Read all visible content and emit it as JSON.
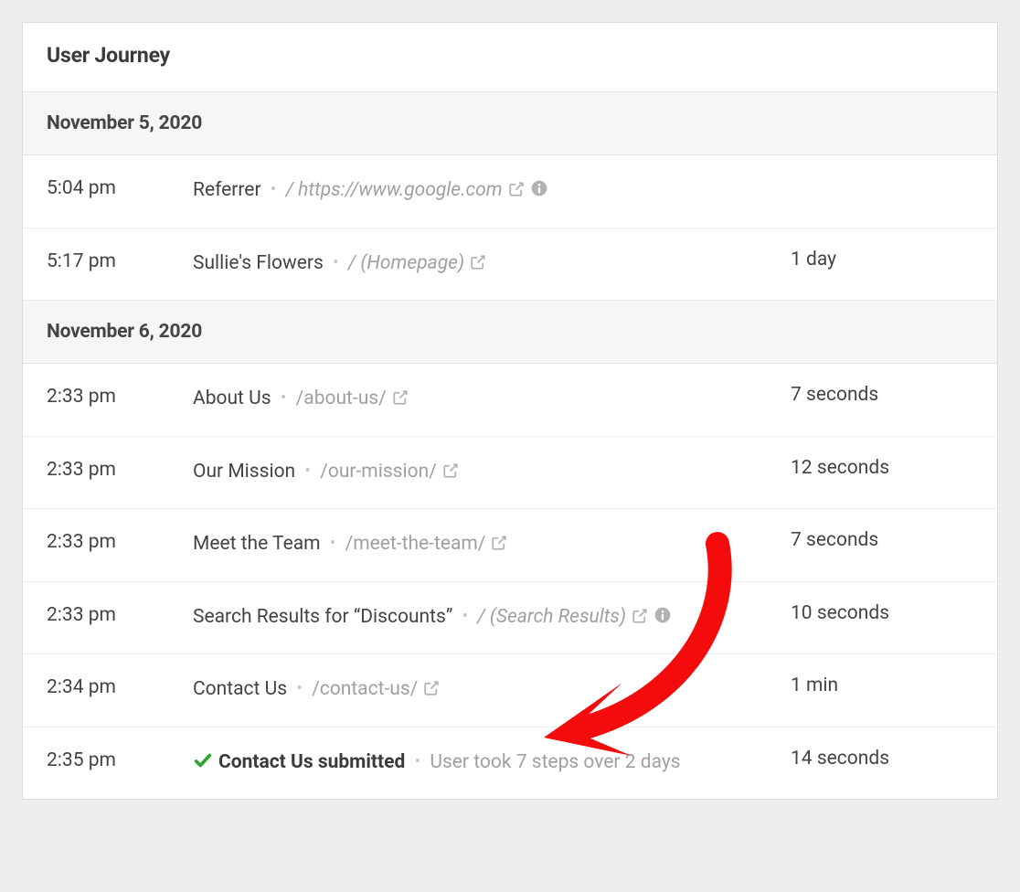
{
  "panel": {
    "title": "User Journey"
  },
  "groups": [
    {
      "date": "November 5, 2020",
      "rows": [
        {
          "time": "5:04 pm",
          "title": "Referrer",
          "title_bold": false,
          "path": "/ https://www.google.com",
          "path_italic": true,
          "external": true,
          "info": true,
          "duration": ""
        },
        {
          "time": "5:17 pm",
          "title": "Sullie's Flowers",
          "title_bold": false,
          "path": "/ (Homepage)",
          "path_italic": true,
          "external": true,
          "info": false,
          "duration": "1 day"
        }
      ]
    },
    {
      "date": "November 6, 2020",
      "rows": [
        {
          "time": "2:33 pm",
          "title": "About Us",
          "title_bold": false,
          "path": "/about-us/",
          "path_italic": false,
          "external": true,
          "info": false,
          "duration": "7 seconds"
        },
        {
          "time": "2:33 pm",
          "title": "Our Mission",
          "title_bold": false,
          "path": "/our-mission/",
          "path_italic": false,
          "external": true,
          "info": false,
          "duration": "12 seconds"
        },
        {
          "time": "2:33 pm",
          "title": "Meet the Team",
          "title_bold": false,
          "path": "/meet-the-team/",
          "path_italic": false,
          "external": true,
          "info": false,
          "duration": "7 seconds"
        },
        {
          "time": "2:33 pm",
          "title": "Search Results for “Discounts”",
          "title_bold": false,
          "path": "/ (Search Results)",
          "path_italic": true,
          "external": true,
          "info": true,
          "duration": "10 seconds"
        },
        {
          "time": "2:34 pm",
          "title": "Contact Us",
          "title_bold": false,
          "path": "/contact-us/",
          "path_italic": false,
          "external": true,
          "info": false,
          "duration": "1 min"
        },
        {
          "time": "2:35 pm",
          "check": true,
          "title": "Contact Us submitted",
          "title_bold": true,
          "note": "User took 7 steps over 2 days",
          "external": false,
          "info": false,
          "duration": "14 seconds"
        }
      ]
    }
  ]
}
